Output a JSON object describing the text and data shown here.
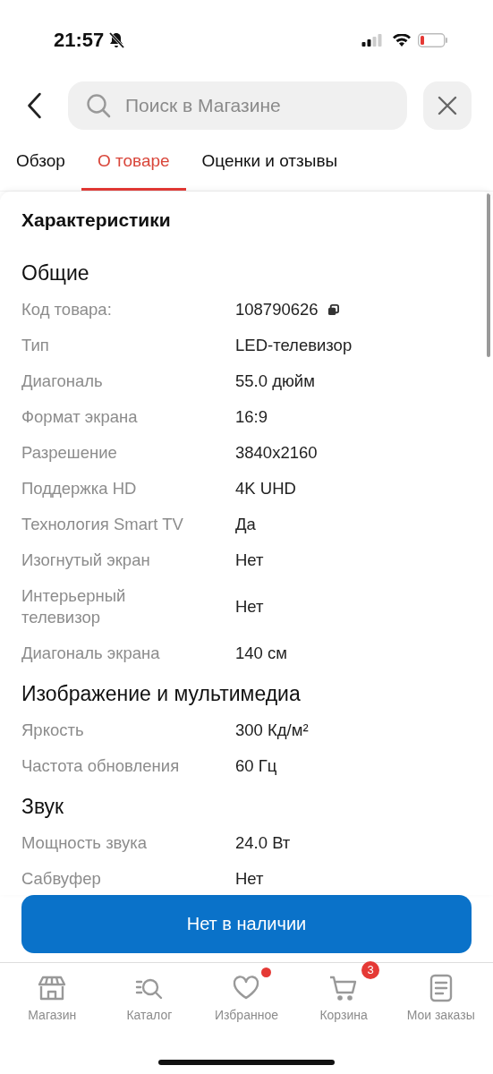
{
  "status_bar": {
    "time": "21:57",
    "muted": true
  },
  "header": {
    "search": {
      "placeholder": "Поиск в Магазине"
    }
  },
  "tabs": [
    {
      "label": "Обзор",
      "selected": false
    },
    {
      "label": "О товаре",
      "selected": true
    },
    {
      "label": "Оценки и отзывы",
      "selected": false
    }
  ],
  "title": "Характеристики",
  "sections": [
    {
      "title": "Общие",
      "rows": [
        {
          "label": "Код товара:",
          "value": "108790626",
          "copy": true
        },
        {
          "label": "Тип",
          "value": "LED-телевизор"
        },
        {
          "label": "Диагональ",
          "value": "55.0 дюйм"
        },
        {
          "label": "Формат экрана",
          "value": "16:9"
        },
        {
          "label": "Разрешение",
          "value": "3840x2160"
        },
        {
          "label": "Поддержка HD",
          "value": "4K UHD"
        },
        {
          "label": "Технология Smart TV",
          "value": "Да"
        },
        {
          "label": "Изогнутый экран",
          "value": "Нет"
        },
        {
          "label": "Интерьерный телевизор",
          "value": "Нет"
        },
        {
          "label": "Диагональ экрана",
          "value": "140 см"
        }
      ]
    },
    {
      "title": "Изображение и мультимедиа",
      "rows": [
        {
          "label": "Яркость",
          "value": "300 Кд/м²"
        },
        {
          "label": "Частота обновления",
          "value": "60 Гц"
        }
      ]
    },
    {
      "title": "Звук",
      "rows": [
        {
          "label": "Мощность звука",
          "value": "24.0 Вт"
        },
        {
          "label": "Сабвуфер",
          "value": "Нет"
        }
      ]
    }
  ],
  "action_button": {
    "label": "Нет в наличии"
  },
  "nav": [
    {
      "kind": "store",
      "label": "Магазин"
    },
    {
      "kind": "catalog",
      "label": "Каталог"
    },
    {
      "kind": "heart",
      "label": "Избранное",
      "dot": true
    },
    {
      "kind": "cart",
      "label": "Корзина",
      "badge": "3"
    },
    {
      "kind": "orders",
      "label": "Мои заказы"
    }
  ]
}
